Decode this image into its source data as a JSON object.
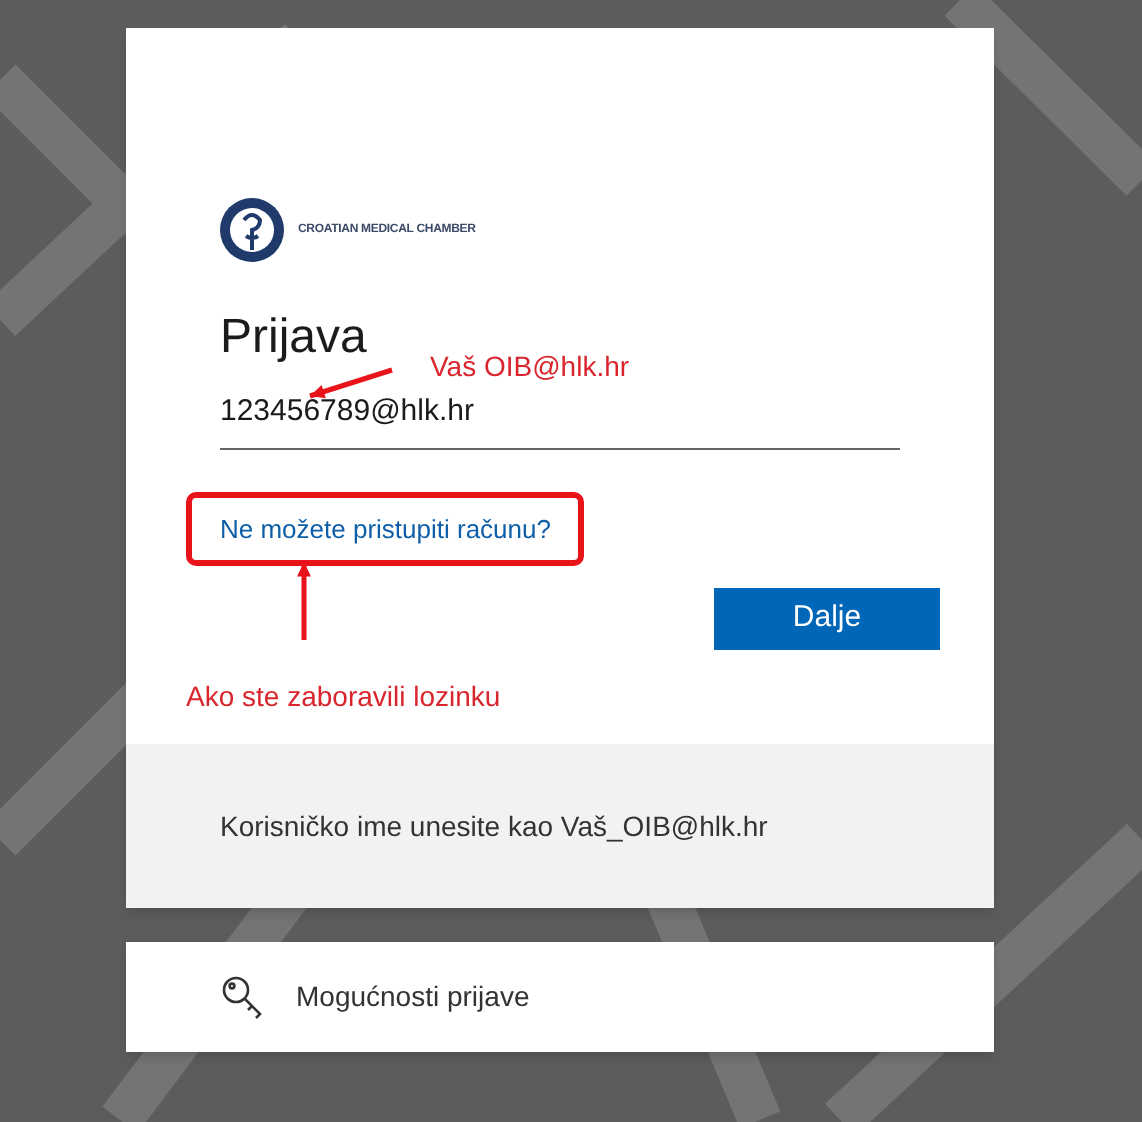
{
  "logo": {
    "text": "CROATIAN MEDICAL CHAMBER"
  },
  "heading": "Prijava",
  "username_field": {
    "value": "123456789@hlk.hr"
  },
  "link": "Ne možete pristupiti računu?",
  "next_button": "Dalje",
  "annotations": [
    {
      "kind": "hint",
      "text": "Vaš OIB@hlk.hr"
    },
    {
      "kind": "hint",
      "text": "Ako ste zaboravili lozinku"
    }
  ],
  "note": "Korisničko ime unesite kao Vaš_OIB@hlk.hr",
  "sign_in_options": "Mogućnosti prijave"
}
